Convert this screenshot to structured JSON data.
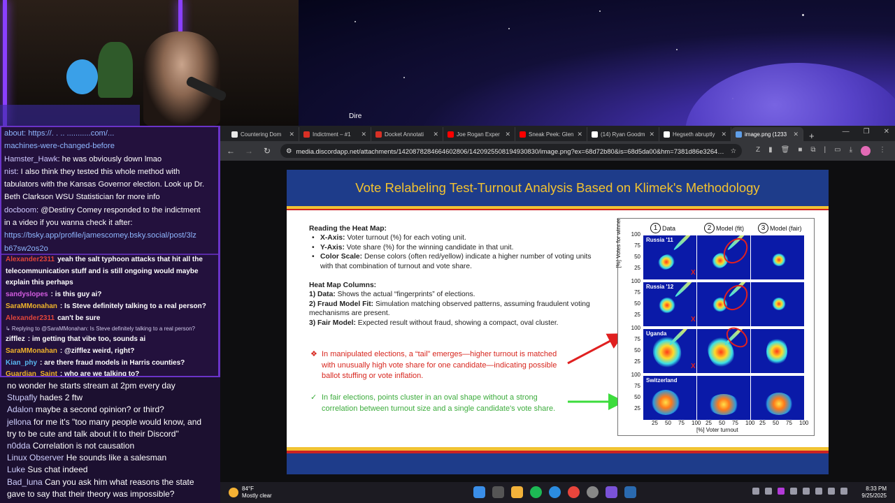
{
  "stream": {
    "overlay_label": "Dire"
  },
  "chat_top": {
    "messages": [
      {
        "user": "",
        "text": "about: https://. . .. ...........com/...",
        "link": true
      },
      {
        "user": "",
        "text": "machines-were-changed-before",
        "link": true
      },
      {
        "user": "Hamster_Hawk",
        "text": ": he was obviously down lmao"
      },
      {
        "user": "nist",
        "text": ": I also think they tested this whole method with"
      },
      {
        "user": "",
        "text": "tabulators with the Kansas Governor election. Look up Dr."
      },
      {
        "user": "",
        "text": "Beth Clarkson WSU Statistician for more info"
      },
      {
        "user": "docboom",
        "text": ": @Destiny Comey responded to the indictment"
      },
      {
        "user": "",
        "text": "in a video if you wanna check it after:"
      },
      {
        "user": "",
        "text": "https://bsky.app/profile/jamescomey.bsky.social/post/3lz",
        "link": true
      },
      {
        "user": "",
        "text": "b67sw2os2o",
        "link": true
      }
    ]
  },
  "chat_mid": {
    "messages": [
      {
        "user": "Alexander2311",
        "color": "#e0453a",
        "text": "yeah the salt typhoon attacks that hit all the"
      },
      {
        "user": "",
        "color": "",
        "text": "telecommunication stuff and is still ongoing would maybe"
      },
      {
        "user": "",
        "color": "",
        "text": "explain this perhaps"
      },
      {
        "user": "sandyslopes",
        "color": "#d25ce0",
        "text": ": is this guy ai?"
      },
      {
        "user": "SaraMMonahan",
        "color": "#f0b42a",
        "text": ": Is Steve definitely talking to a real person?"
      },
      {
        "user": "Alexander2311",
        "color": "#e0453a",
        "text": "can't be sure"
      },
      {
        "user": "",
        "color": "",
        "text": "↳ Replying to @SaraMMonahan: Is Steve definitely talking to a real person?",
        "reply": true
      },
      {
        "user": "zifflez",
        "color": "#ffffff",
        "text": ": im getting that vibe too, sounds ai"
      },
      {
        "user": "SaraMMonahan",
        "color": "#f0b42a",
        "text": ": @zifflez weird, right?"
      },
      {
        "user": "Kian_phy",
        "color": "#58b6f0",
        "text": ": are there fraud models in Harris counties?"
      },
      {
        "user": "Guardian_Saint",
        "color": "#f0b42a",
        "text": ": who are we talking to?"
      }
    ]
  },
  "chat_bottom": {
    "messages": [
      {
        "user": "",
        "text": "no wonder he starts stream at 2pm every day"
      },
      {
        "user": "Stupafly",
        "text": "hades 2 ftw"
      },
      {
        "user": "Adalon",
        "text": "maybe a second opinion? or third?"
      },
      {
        "user": "jellona",
        "text": "for me it's \"too many people would know, and"
      },
      {
        "user": "",
        "text": "try to be cute and talk about it to their Discord\""
      },
      {
        "user": "n0dda",
        "text": "Correlation is not causation"
      },
      {
        "user": "Linux Observer",
        "text": "He sounds like a salesman"
      },
      {
        "user": "Luke",
        "text": "Sus chat indeed"
      },
      {
        "user": "Bad_luna",
        "text": "Can you ask him what reasons the state"
      },
      {
        "user": "",
        "text": "gave to say that their theory was impossible?"
      }
    ]
  },
  "browser": {
    "tabs": [
      {
        "title": "Countering Dom",
        "color": "#e8e8e8"
      },
      {
        "title": "Indictment – #1",
        "color": "#d93025"
      },
      {
        "title": "Docket Annotati",
        "color": "#d93025"
      },
      {
        "title": "Joe Rogan Exper",
        "color": "#ff0000"
      },
      {
        "title": "Sneak Peek: Glen",
        "color": "#ff0000"
      },
      {
        "title": "(14) Ryan Goodm",
        "color": "#ffffff"
      },
      {
        "title": "Hegseth abruptly",
        "color": "#ffffff"
      },
      {
        "title": "image.png (1233",
        "color": "#5f9ee8",
        "active": true
      }
    ],
    "url": "media.discordapp.net/attachments/1420878284664602806/1420925508194930830/image.png?ex=68d72b80&is=68d5da00&hm=7381d86e32644e9873b65f41..."
  },
  "slide": {
    "title": "Vote Relabeling Test-Turnout Analysis Based on Klimek's Methodology",
    "reading_header": "Reading the Heat Map:",
    "reading_items": [
      {
        "label": "X-Axis:",
        "text": " Voter turnout (%) for each voting unit."
      },
      {
        "label": "Y-Axis:",
        "text": " Vote share (%) for the winning candidate in that unit."
      },
      {
        "label": "Color Scale:",
        "text": " Dense colors (often red/yellow) indicate a higher number of voting units with that combination of turnout and vote share."
      }
    ],
    "columns_header": "Heat Map Columns:",
    "column_items": [
      {
        "label": "1) Data:",
        "text": " Shows the actual “fingerprints” of elections."
      },
      {
        "label": "2) Fraud Model Fit:",
        "text": " Simulation matching observed patterns, assuming fraudulent voting mechanisms are present."
      },
      {
        "label": "3) Fair Model:",
        "text": " Expected result without fraud, showing a compact, oval cluster."
      }
    ],
    "callout_red": "In manipulated elections, a “tail” emerges—higher turnout is matched with unusually high vote share for one candidate—indicating possible ballot stuffing or vote inflation.",
    "callout_green": "In fair elections, points cluster in an oval shape without a strong correlation between turnout size and a single candidate's vote share.",
    "callout_red_marker": "❖",
    "callout_green_marker": "✓",
    "figure": {
      "col_headers": [
        {
          "num": "1",
          "label": "Data"
        },
        {
          "num": "2",
          "label": "Model (fit)"
        },
        {
          "num": "3",
          "label": "Model (fair)"
        }
      ],
      "rows": [
        "Russia '11",
        "Russia '12",
        "Uganda",
        "Switzerland"
      ],
      "y_ticks": [
        "100",
        "75",
        "50",
        "25"
      ],
      "x_ticks": [
        "25",
        "50",
        "75",
        "100",
        "25",
        "50",
        "75",
        "100",
        "25",
        "50",
        "75",
        "100"
      ],
      "y_label": "[%] Votes for winner",
      "x_label": "[%] Voter turnout",
      "x_mark": "X"
    }
  },
  "taskbar": {
    "temp": "84°F",
    "condition": "Mostly clear",
    "time": "8:33 PM",
    "date": "9/25/2025"
  },
  "colors": {
    "slide_blue": "#1e3c8a",
    "slide_gold": "#f1c232",
    "alert_red": "#d7261e",
    "ok_green": "#3dac3d",
    "chat_border": "#6a33c8"
  }
}
